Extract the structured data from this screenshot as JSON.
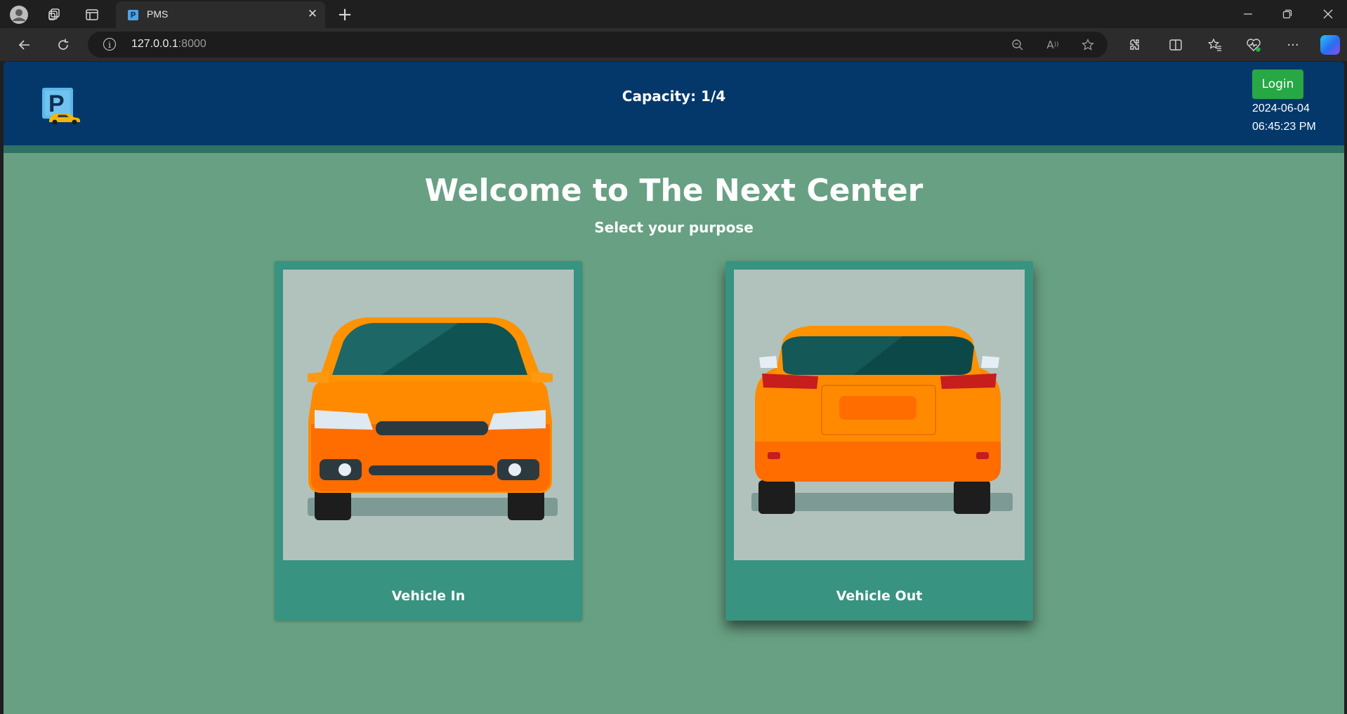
{
  "browser": {
    "tab_title": "PMS",
    "url_host": "127.0.0.1",
    "url_port": ":8000"
  },
  "header": {
    "capacity": "Capacity: 1/4",
    "login_label": "Login",
    "date": "2024-06-04",
    "time": "06:45:23 PM"
  },
  "main": {
    "title": "Welcome to The Next Center",
    "subtitle": "Select your purpose",
    "cards": [
      {
        "label": "Vehicle In"
      },
      {
        "label": "Vehicle Out"
      }
    ]
  },
  "colors": {
    "header_bg": "#04386b",
    "page_bg": "#68a083",
    "card_bg": "#389380",
    "login_bg": "#28a745",
    "car_orange": "#ff8a00"
  }
}
